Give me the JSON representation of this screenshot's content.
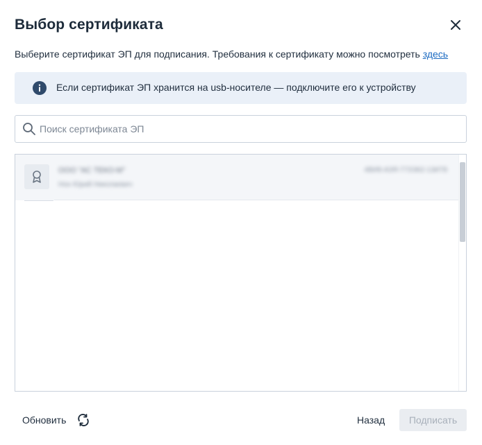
{
  "dialog": {
    "title": "Выбор сертификата",
    "subtitle_text": "Выберите сертификат ЭП для подписания. Требования к сертификату можно посмотреть ",
    "subtitle_link": "здесь",
    "info_text": "Если сертификат ЭП хранится на usb-носителе — подключите его к устройству",
    "search_placeholder": "Поиск сертификата ЭП",
    "search_value": ""
  },
  "certificates": [
    {
      "name": "ООО \"АС ТЕКО-М\"",
      "owner": "Нон Юрий Николаевич",
      "id": "4ВИ8-АЗЯ-77ЗЭ62-13И78",
      "icon": "certificate-icon"
    }
  ],
  "footer": {
    "refresh_label": "Обновить",
    "back_label": "Назад",
    "sign_label": "Подписать"
  },
  "colors": {
    "accent": "#1c6bc2",
    "info_bg": "#eaf0f8",
    "disabled_bg": "#eaedf1"
  },
  "icons": {
    "close": "close-icon",
    "info": "info-icon",
    "search": "search-icon",
    "refresh": "refresh-icon"
  }
}
